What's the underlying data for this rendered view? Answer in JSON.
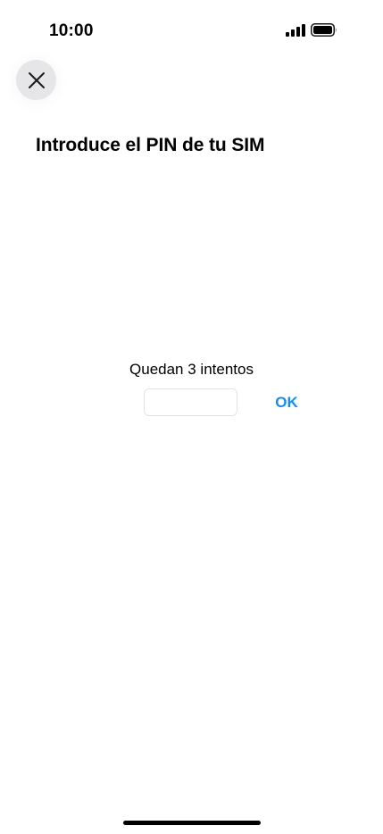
{
  "status_bar": {
    "time": "10:00",
    "icons": [
      "signal-bars-icon",
      "battery-icon"
    ]
  },
  "header": {
    "close_icon": "close-icon",
    "title": "Introduce el PIN de tu SIM"
  },
  "pin_form": {
    "attempts_label": "Quedan 3 intentos",
    "pin_value": "",
    "pin_placeholder": "",
    "ok_label": "OK"
  },
  "colors": {
    "accent": "#1a8cf0",
    "close_button_bg": "#e6e6e9",
    "input_border": "#e3e3e6"
  }
}
